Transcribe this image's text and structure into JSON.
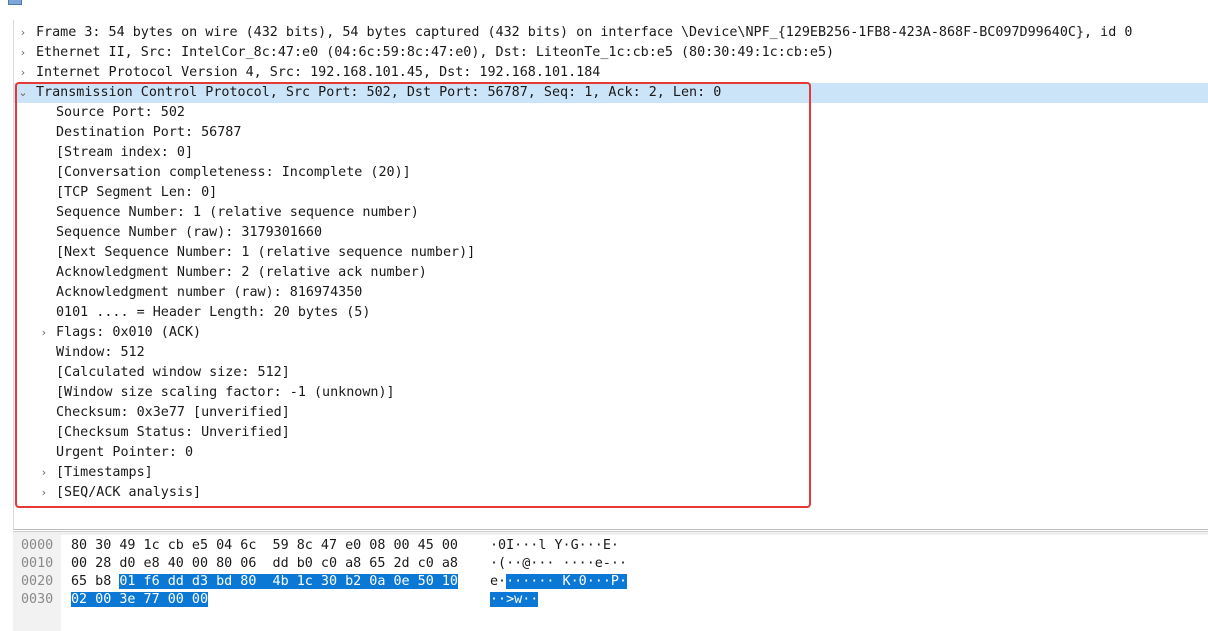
{
  "detail_rows": [
    {
      "text": "Frame 3: 54 bytes on wire (432 bits), 54 bytes captured (432 bits) on interface \\Device\\NPF_{129EB256-1FB8-423A-868F-BC097D99640C}, id 0",
      "expander": ">"
    },
    {
      "text": "Ethernet II, Src: IntelCor_8c:47:e0 (04:6c:59:8c:47:e0), Dst: LiteonTe_1c:cb:e5 (80:30:49:1c:cb:e5)",
      "expander": ">"
    },
    {
      "text": "Internet Protocol Version 4, Src: 192.168.101.45, Dst: 192.168.101.184",
      "expander": ">"
    },
    {
      "text": "Transmission Control Protocol, Src Port: 502, Dst Port: 56787, Seq: 1, Ack: 2, Len: 0",
      "expander": "v"
    },
    {
      "text": "Source Port: 502",
      "expander": ""
    },
    {
      "text": "Destination Port: 56787",
      "expander": ""
    },
    {
      "text": "[Stream index: 0]",
      "expander": ""
    },
    {
      "text": "[Conversation completeness: Incomplete (20)]",
      "expander": ""
    },
    {
      "text": "[TCP Segment Len: 0]",
      "expander": ""
    },
    {
      "text": "Sequence Number: 1    (relative sequence number)",
      "expander": ""
    },
    {
      "text": "Sequence Number (raw): 3179301660",
      "expander": ""
    },
    {
      "text": "[Next Sequence Number: 1    (relative sequence number)]",
      "expander": ""
    },
    {
      "text": "Acknowledgment Number: 2    (relative ack number)",
      "expander": ""
    },
    {
      "text": "Acknowledgment number (raw): 816974350",
      "expander": ""
    },
    {
      "text": "0101 .... = Header Length: 20 bytes (5)",
      "expander": ""
    },
    {
      "text": "Flags: 0x010 (ACK)",
      "expander": ">"
    },
    {
      "text": "Window: 512",
      "expander": ""
    },
    {
      "text": "[Calculated window size: 512]",
      "expander": ""
    },
    {
      "text": "[Window size scaling factor: -1 (unknown)]",
      "expander": ""
    },
    {
      "text": "Checksum: 0x3e77 [unverified]",
      "expander": ""
    },
    {
      "text": "[Checksum Status: Unverified]",
      "expander": ""
    },
    {
      "text": "Urgent Pointer: 0",
      "expander": ""
    },
    {
      "text": "[Timestamps]",
      "expander": ">"
    },
    {
      "text": "[SEQ/ACK analysis]",
      "expander": ">"
    }
  ],
  "bytes": [
    {
      "offset": "0000",
      "hex_plain": "80 30 49 1c cb e5 04 6c  59 8c 47 e0 08 00 45 00",
      "hex_sel": "",
      "hex_after": "",
      "ascii_plain": "·0I···l Y·G···E·",
      "ascii_sel": ""
    },
    {
      "offset": "0010",
      "hex_plain": "00 28 d0 e8 40 00 80 06  dd b0 c0 a8 65 2d c0 a8",
      "hex_sel": "",
      "hex_after": "",
      "ascii_plain": "·(··@··· ····e-··",
      "ascii_sel": ""
    },
    {
      "offset": "0020",
      "hex_plain": "65 b8 ",
      "hex_sel": "01 f6 dd d3 bd 80  4b 1c 30 b2 0a 0e 50 10",
      "hex_after": "",
      "ascii_plain": "e·",
      "ascii_sel": "······ K·0···P·"
    },
    {
      "offset": "0030",
      "hex_plain": "",
      "hex_sel": "02 00 3e 77 00 00",
      "hex_after": "",
      "ascii_plain": "",
      "ascii_sel": "··>w··"
    }
  ],
  "colors": {
    "selected_row": "#cce4f7",
    "highlight_box": "#e53935",
    "byte_selection": "#0a78d4"
  }
}
